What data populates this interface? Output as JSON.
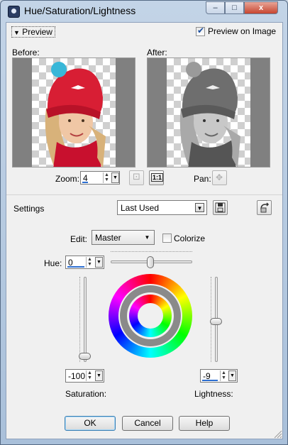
{
  "window": {
    "title": "Hue/Saturation/Lightness",
    "minimize": "–",
    "maximize": "□",
    "close": "x"
  },
  "preview": {
    "label": "Preview",
    "preview_on_image_label": "Preview on Image",
    "preview_on_image_checked": true
  },
  "before": {
    "label": "Before:"
  },
  "after": {
    "label": "After:"
  },
  "zoom": {
    "label": "Zoom:",
    "value": "4"
  },
  "pan": {
    "label": "Pan:"
  },
  "settings": {
    "label": "Settings",
    "selected": "Last Used"
  },
  "edit": {
    "label": "Edit:",
    "selected": "Master",
    "colorize_label": "Colorize",
    "colorize_checked": false
  },
  "hue": {
    "label": "Hue:",
    "value": "0"
  },
  "saturation": {
    "label": "Saturation:",
    "value": "-100"
  },
  "lightness": {
    "label": "Lightness:",
    "value": "-9"
  },
  "buttons": {
    "ok": "OK",
    "cancel": "Cancel",
    "help": "Help"
  },
  "icons": {
    "one_to_one": "1:1",
    "move": "✥",
    "fit": "⊡",
    "save": "save-icon",
    "dropdown": "▼",
    "spin": "▲▼"
  },
  "colors": {
    "accent": "#2d6fd1",
    "titlebar": "#b7cbe2",
    "close": "#c7452f"
  }
}
